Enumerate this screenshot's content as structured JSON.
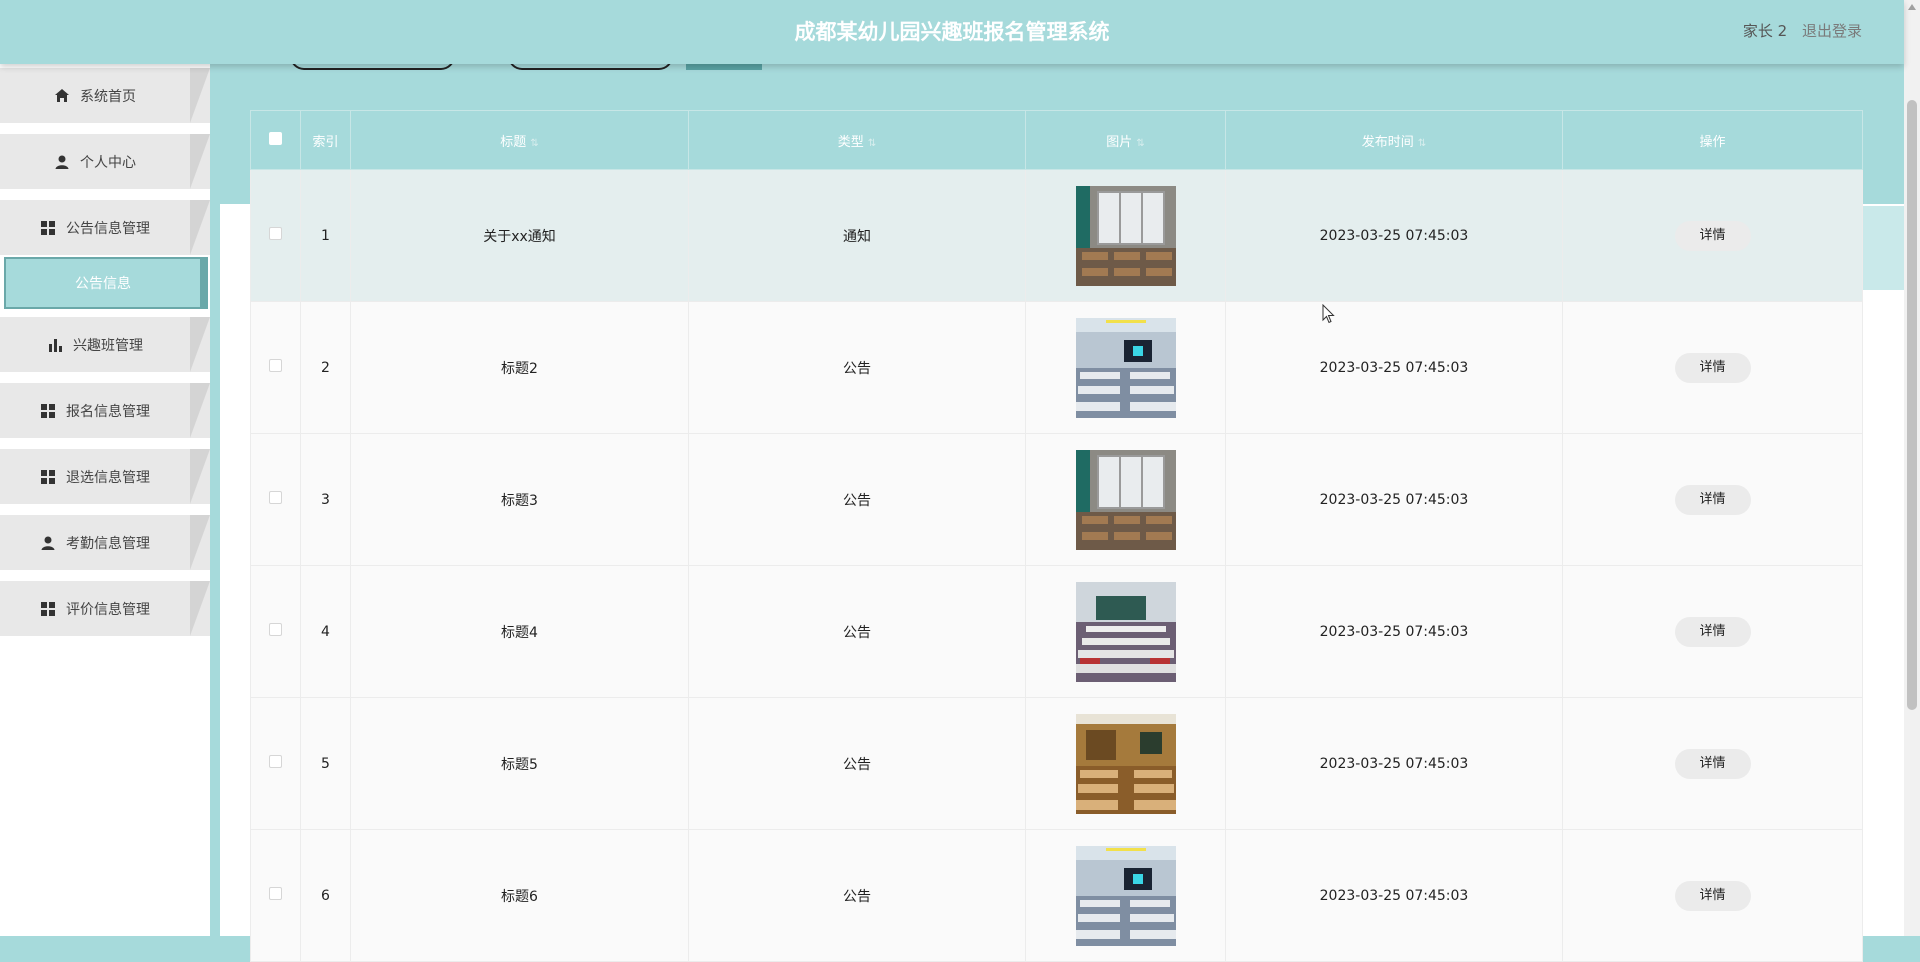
{
  "header": {
    "title": "成都某幼儿园兴趣班报名管理系统",
    "username": "家长 2",
    "logout": "退出登录"
  },
  "sidebar": {
    "items": [
      {
        "label": "系统首页",
        "icon": "home-icon"
      },
      {
        "label": "个人中心",
        "icon": "user-icon"
      },
      {
        "label": "公告信息管理",
        "icon": "grid-icon"
      },
      {
        "label": "兴趣班管理",
        "icon": "bar-chart-icon"
      },
      {
        "label": "报名信息管理",
        "icon": "grid-icon"
      },
      {
        "label": "退选信息管理",
        "icon": "grid-icon"
      },
      {
        "label": "考勤信息管理",
        "icon": "user-icon"
      },
      {
        "label": "评价信息管理",
        "icon": "grid-icon"
      }
    ],
    "active_sub": "公告信息"
  },
  "table": {
    "columns": [
      "索引",
      "标题",
      "类型",
      "图片",
      "发布时间",
      "操作"
    ],
    "action_label": "详情",
    "rows": [
      {
        "index": "1",
        "title": "关于xx通知",
        "type": "通知",
        "image": "classroom-window",
        "time": "2023-03-25 07:45:03"
      },
      {
        "index": "2",
        "title": "标题2",
        "type": "公告",
        "image": "classroom-screen",
        "time": "2023-03-25 07:45:03"
      },
      {
        "index": "3",
        "title": "标题3",
        "type": "公告",
        "image": "classroom-window",
        "time": "2023-03-25 07:45:03"
      },
      {
        "index": "4",
        "title": "标题4",
        "type": "公告",
        "image": "classroom-desks",
        "time": "2023-03-25 07:45:03"
      },
      {
        "index": "5",
        "title": "标题5",
        "type": "公告",
        "image": "classroom-wood",
        "time": "2023-03-25 07:45:03"
      },
      {
        "index": "6",
        "title": "标题6",
        "type": "公告",
        "image": "classroom-screen",
        "time": "2023-03-25 07:45:03"
      }
    ]
  },
  "colors": {
    "accent": "#a6dadb",
    "accent_dark": "#6aa8a9"
  }
}
